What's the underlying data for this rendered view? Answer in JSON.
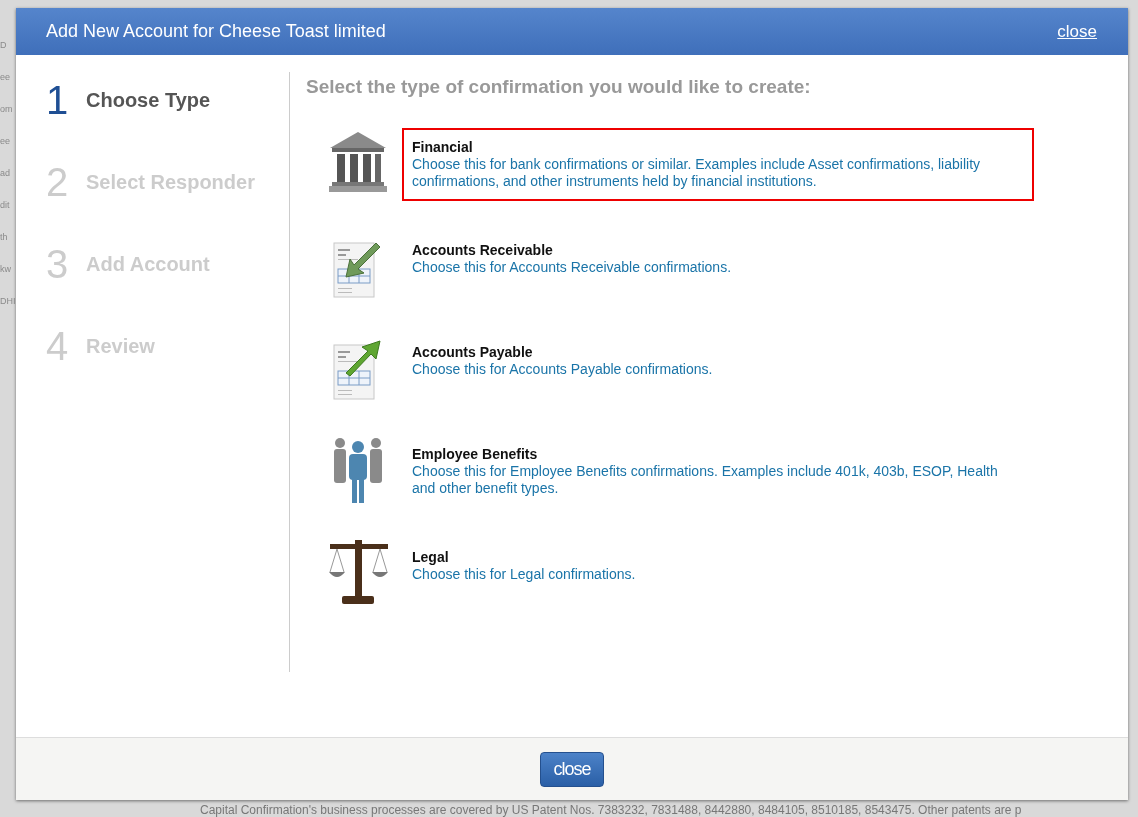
{
  "background": {
    "side_fragments": [
      "D",
      "ee",
      "om",
      "ee",
      "ad",
      "dit",
      "th",
      "kw",
      "DHI"
    ],
    "footer_note": "Capital Confirmation's business processes are covered by US Patent Nos. 7383232, 7831488, 8442880, 8484105, 8510185, 8543475. Other patents are p"
  },
  "dialog": {
    "title": "Add New Account for Cheese Toast limited",
    "close_link": "close",
    "steps": [
      {
        "number": "1",
        "label": "Choose Type",
        "selected": true
      },
      {
        "number": "2",
        "label": "Select Responder",
        "selected": false
      },
      {
        "number": "3",
        "label": "Add Account",
        "selected": false
      },
      {
        "number": "4",
        "label": "Review",
        "selected": false
      }
    ],
    "heading": "Select the type of confirmation you would like to create:",
    "options": [
      {
        "kind": "bank",
        "title": "Financial",
        "description": "Choose this for bank confirmations or similar. Examples include Asset confirmations, liability confirmations, and other instruments held by financial institutions.",
        "selected": true
      },
      {
        "kind": "receivable",
        "title": "Accounts Receivable",
        "description": "Choose this for Accounts Receivable confirmations.",
        "selected": false
      },
      {
        "kind": "payable",
        "title": "Accounts Payable",
        "description": "Choose this for Accounts Payable confirmations.",
        "selected": false
      },
      {
        "kind": "people",
        "title": "Employee Benefits",
        "description": "Choose this for Employee Benefits confirmations. Examples include 401k, 403b, ESOP, Health and other benefit types.",
        "selected": false
      },
      {
        "kind": "scales",
        "title": "Legal",
        "description": "Choose this for Legal confirmations.",
        "selected": false
      }
    ],
    "close_button": "close"
  }
}
